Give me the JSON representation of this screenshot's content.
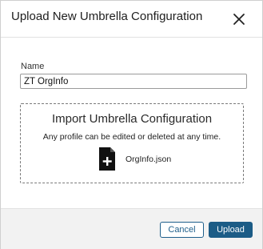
{
  "dialog": {
    "title": "Upload New Umbrella Configuration",
    "close_icon": "close-icon"
  },
  "form": {
    "name_label": "Name",
    "name_value": "ZT OrgInfo"
  },
  "dropzone": {
    "title": "Import Umbrella Configuration",
    "subtitle": "Any profile can be edited or deleted at any time.",
    "file_icon": "file-add-icon",
    "file_name": "OrgInfo.json"
  },
  "footer": {
    "cancel_label": "Cancel",
    "upload_label": "Upload"
  },
  "colors": {
    "primary": "#1c5c86",
    "footer_bg": "#f2f2f2"
  }
}
